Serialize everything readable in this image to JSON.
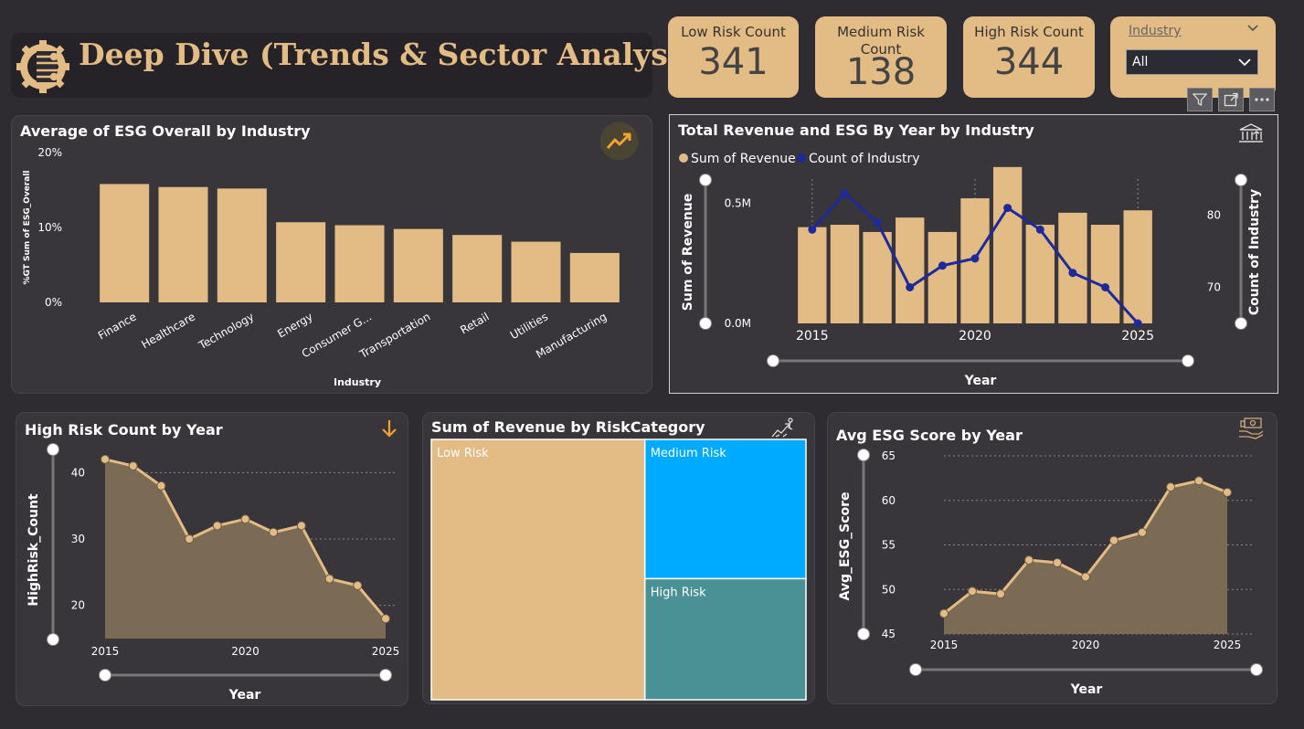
{
  "header": {
    "title": "Deep Dive (Trends & Sector Analysis)"
  },
  "kpis": {
    "low": {
      "label": "Low Risk Count",
      "value": "341"
    },
    "medium": {
      "label": "Medium Risk Count",
      "value": "138"
    },
    "high": {
      "label": "High Risk Count",
      "value": "344"
    }
  },
  "slicer": {
    "label": "Industry",
    "selected": "All"
  },
  "toolbar": {
    "icons": [
      "filter-icon",
      "focus-mode-icon",
      "more-options-icon"
    ]
  },
  "panels": {
    "esg_industry": {
      "title": "Average of ESG Overall by Industry",
      "icon": "trend-up-icon"
    },
    "rev_esg_year": {
      "title": "Total Revenue and ESG By Year by Industry",
      "icon": "bank-icon"
    },
    "high_risk_year": {
      "title": "High Risk Count by Year",
      "icon": "arrow-down-icon"
    },
    "rev_risk": {
      "title": "Sum of Revenue by RiskCategory",
      "icon": "growth-icon"
    },
    "avg_esg_year": {
      "title": "Avg ESG Score by Year",
      "icon": "money-hand-icon"
    }
  },
  "colors": {
    "accent": "#e3bb84",
    "navy": "#1f2a9a",
    "blue": "#00aaff",
    "teal": "#4a9196",
    "icon_orange": "#f2a32e"
  },
  "chart_data": [
    {
      "id": "esg_industry",
      "type": "bar",
      "title": "Average of ESG Overall by Industry",
      "xlabel": "Industry",
      "ylabel": "%GT Sum of ESG_Overall",
      "categories": [
        "Finance",
        "Healthcare",
        "Technology",
        "Energy",
        "Consumer G...",
        "Transportation",
        "Retail",
        "Utilities",
        "Manufacturing"
      ],
      "values": [
        15.8,
        15.4,
        15.2,
        10.7,
        10.3,
        9.8,
        9.0,
        8.1,
        6.6
      ],
      "yticks": [
        "0%",
        "10%",
        "20%"
      ],
      "ylim": [
        0,
        20
      ]
    },
    {
      "id": "rev_esg_year",
      "type": "bar",
      "title": "Total Revenue and ESG By Year by Industry",
      "xlabel": "Year",
      "ylabel": "Sum of Revenue",
      "y2label": "Count of Industry",
      "x": [
        2015,
        2016,
        2017,
        2018,
        2019,
        2020,
        2021,
        2022,
        2023,
        2024,
        2025
      ],
      "xticks": [
        "2015",
        "2020",
        "2025"
      ],
      "yticks": [
        "0.0M",
        "0.5M"
      ],
      "y2ticks": [
        "70",
        "80"
      ],
      "series": [
        {
          "name": "Sum of Revenue",
          "type": "bar",
          "values": [
            0.4,
            0.41,
            0.38,
            0.44,
            0.38,
            0.52,
            0.65,
            0.41,
            0.46,
            0.41,
            0.47
          ],
          "unit": "M"
        },
        {
          "name": "Count of Industry",
          "type": "line",
          "values": [
            78,
            83,
            79,
            70,
            73,
            74,
            81,
            78,
            72,
            70,
            65
          ]
        }
      ],
      "ylim": [
        0,
        0.6
      ],
      "y2lim": [
        65,
        85
      ],
      "legend": "top-left"
    },
    {
      "id": "high_risk_year",
      "type": "area",
      "title": "High Risk Count by Year",
      "xlabel": "Year",
      "ylabel": "HighRisk_Count",
      "x": [
        2015,
        2016,
        2017,
        2018,
        2019,
        2020,
        2021,
        2022,
        2023,
        2024,
        2025
      ],
      "values": [
        42,
        41,
        38,
        30,
        32,
        33,
        31,
        32,
        24,
        23,
        18
      ],
      "xticks": [
        "2015",
        "2020",
        "2025"
      ],
      "yticks": [
        "20",
        "30",
        "40"
      ],
      "ylim": [
        15,
        45
      ]
    },
    {
      "id": "rev_risk",
      "type": "treemap",
      "title": "Sum of Revenue by RiskCategory",
      "categories": [
        "Low Risk",
        "Medium Risk",
        "High Risk"
      ],
      "values": [
        57,
        23,
        20
      ]
    },
    {
      "id": "avg_esg_year",
      "type": "area",
      "title": "Avg ESG Score by Year",
      "xlabel": "Year",
      "ylabel": "Avg_ESG_Score",
      "x": [
        2015,
        2016,
        2017,
        2018,
        2019,
        2020,
        2021,
        2022,
        2023,
        2024,
        2025
      ],
      "values": [
        47.3,
        49.8,
        49.5,
        53.3,
        53.0,
        51.4,
        55.5,
        56.4,
        61.5,
        62.2,
        60.9
      ],
      "xticks": [
        "2015",
        "2020",
        "2025"
      ],
      "yticks": [
        "45",
        "50",
        "55",
        "60",
        "65"
      ],
      "ylim": [
        45,
        65
      ]
    }
  ]
}
